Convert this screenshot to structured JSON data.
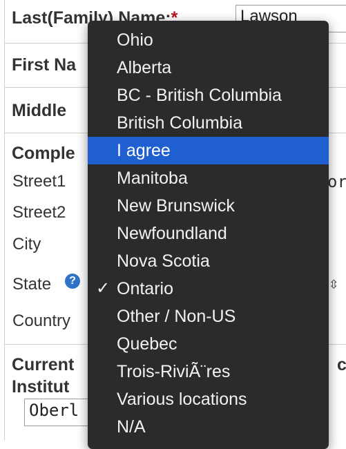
{
  "form": {
    "last_name_label": "Last(Family) Name:",
    "required_mark": "*",
    "last_name_value": "Lawson",
    "first_name_label": "First Na",
    "middle_label": "Middle",
    "complete_label": "Comple",
    "street1_label": "Street1",
    "street2_label": "Street2",
    "city_label": "City",
    "state_label": "State",
    "help_glyph": "?",
    "country_label": "Country",
    "current_label": "Current",
    "current_tail": "c",
    "institution_label": "Institut",
    "institution_value": "Oberl",
    "street1_edge_text": "or",
    "state_edge_glyph": "⇳"
  },
  "dropdown": {
    "options": [
      {
        "label": "Ohio",
        "selected": false,
        "highlighted": false
      },
      {
        "label": "Alberta",
        "selected": false,
        "highlighted": false
      },
      {
        "label": "BC - British Columbia",
        "selected": false,
        "highlighted": false
      },
      {
        "label": "British Columbia",
        "selected": false,
        "highlighted": false
      },
      {
        "label": "I agree",
        "selected": false,
        "highlighted": true
      },
      {
        "label": "Manitoba",
        "selected": false,
        "highlighted": false
      },
      {
        "label": "New Brunswick",
        "selected": false,
        "highlighted": false
      },
      {
        "label": "Newfoundland",
        "selected": false,
        "highlighted": false
      },
      {
        "label": "Nova Scotia",
        "selected": false,
        "highlighted": false
      },
      {
        "label": "Ontario",
        "selected": true,
        "highlighted": false
      },
      {
        "label": "Other / Non-US",
        "selected": false,
        "highlighted": false
      },
      {
        "label": "Quebec",
        "selected": false,
        "highlighted": false
      },
      {
        "label": "Trois-RiviÃ¨res",
        "selected": false,
        "highlighted": false
      },
      {
        "label": "Various locations",
        "selected": false,
        "highlighted": false
      },
      {
        "label": "N/A",
        "selected": false,
        "highlighted": false
      }
    ],
    "check_glyph": "✓"
  },
  "colors": {
    "menu_bg": "#2b2b2c",
    "highlight": "#1f5fd0",
    "required": "#b0171f",
    "help_icon": "#2f73c9"
  }
}
